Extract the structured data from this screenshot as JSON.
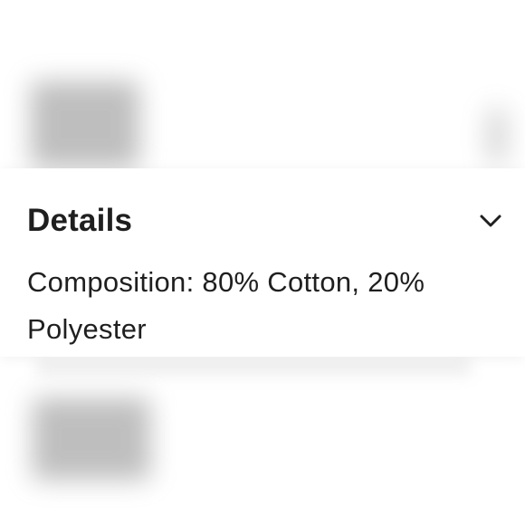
{
  "details": {
    "title": "Details",
    "composition": "Composition: 80% Cotton, 20% Polyester",
    "chevron_icon": "chevron-down-icon",
    "text_color": "#1f1f1f"
  }
}
